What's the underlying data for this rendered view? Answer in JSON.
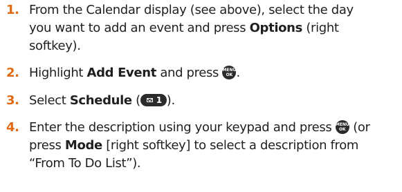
{
  "steps": [
    {
      "number": "1.",
      "lines": [
        [
          "From the Calendar display (see above), select the day"
        ],
        [
          "you want to add an event and press ",
          "Options",
          " (right"
        ],
        [
          "softkey)."
        ]
      ]
    },
    {
      "number": "2.",
      "parts": [
        "Highlight ",
        "Add Event",
        " and press ",
        "."
      ]
    },
    {
      "number": "3.",
      "parts": [
        "Select ",
        "Schedule",
        " (",
        ")."
      ]
    },
    {
      "number": "4.",
      "lines": [
        [
          "Enter the description using your keypad and press ",
          " (or"
        ],
        [
          "press ",
          "Mode",
          " [right softkey] to select a description from"
        ],
        [
          "“From To Do List”)."
        ]
      ]
    }
  ],
  "keys": {
    "menu_ok_top": "MENU",
    "menu_ok_bottom": "OK",
    "schedule_key_number": "1",
    "schedule_key_icon": "envelope-icon"
  },
  "colors": {
    "step_number": "#e06a14",
    "text": "#1f1f1f",
    "key": "#2b2b2b"
  }
}
